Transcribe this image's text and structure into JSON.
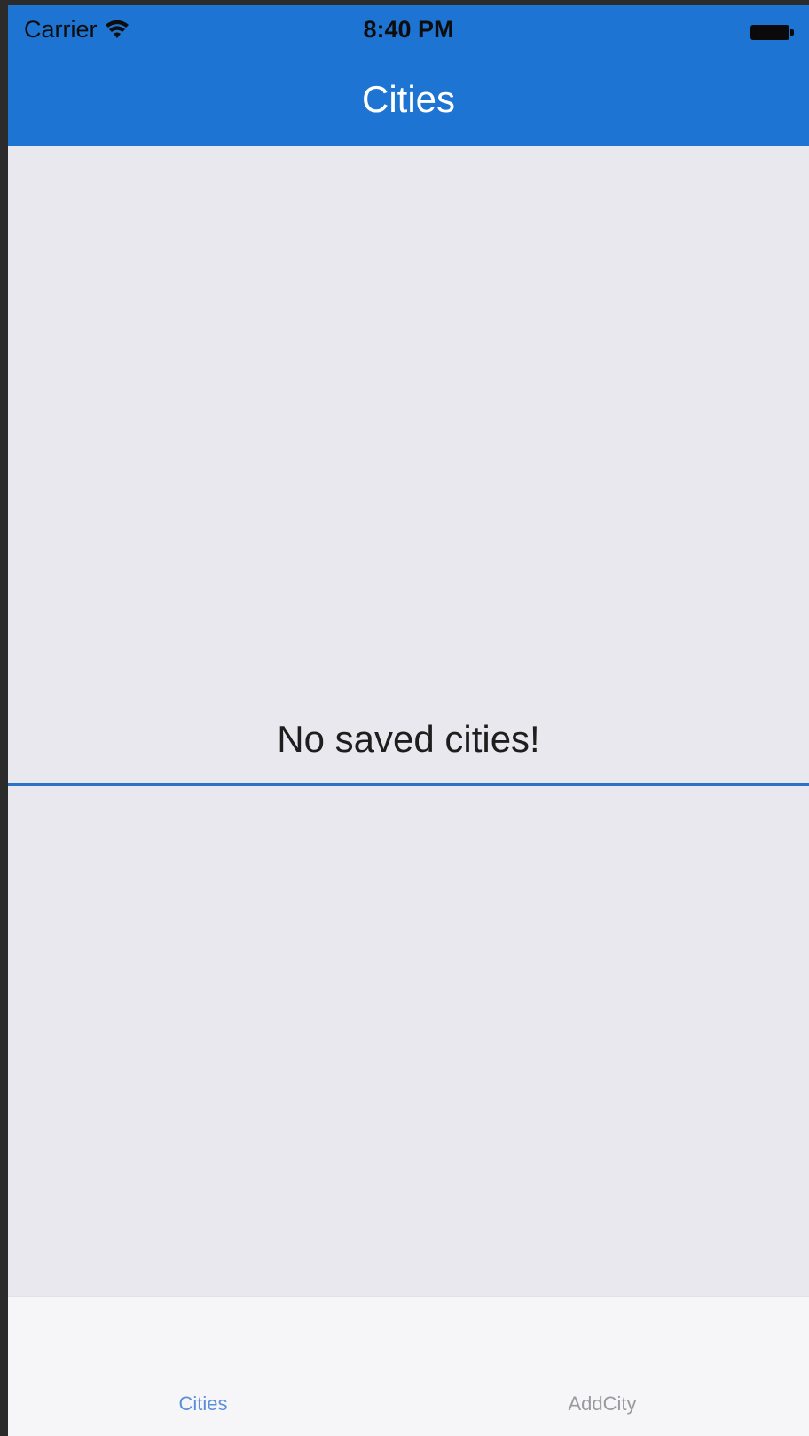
{
  "status_bar": {
    "carrier": "Carrier",
    "time": "8:40 PM",
    "wifi_icon": "wifi-icon",
    "battery_icon": "battery-icon"
  },
  "nav_bar": {
    "title": "Cities",
    "color": "#1d74d2"
  },
  "content": {
    "empty_message": "No saved cities!",
    "background": "#e9e8ee",
    "separator_color": "#2c72c6"
  },
  "tab_bar": {
    "tabs": [
      {
        "label": "Cities",
        "selected": true,
        "color": "#5b8fdb"
      },
      {
        "label": "AddCity",
        "selected": false,
        "color": "#9a9a9e"
      }
    ]
  }
}
